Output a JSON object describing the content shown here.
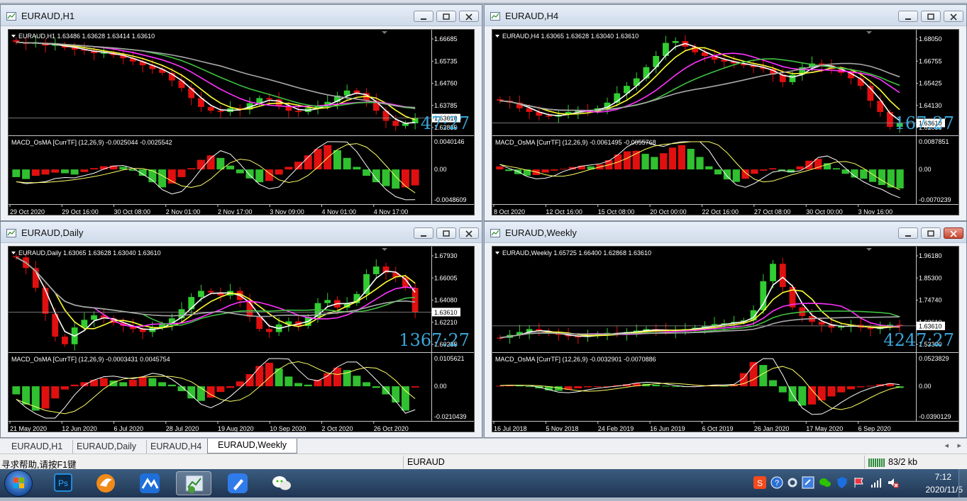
{
  "colors": {
    "bull_candle": "#32cd32",
    "bear_candle": "#e01010",
    "ma_white": "#ffffff",
    "ma_yellow": "#ffff33",
    "ma_magenta": "#ff33ff",
    "ma_green": "#40c040",
    "ma_gray": "#a8a8a8",
    "osma_up": "#e01010",
    "osma_down": "#30c030",
    "timer_text": "#3aa6d8",
    "price_tag_bg": "#ffffff"
  },
  "windows": [
    {
      "id": "h1",
      "title": "EURAUD,H1",
      "close_red": false,
      "chart_header": "EURAUD,H1  1.63486 1.63628 1.63414 1.63610",
      "price_labels": [
        "1.66685",
        "1.65735",
        "1.64760",
        "1.63785",
        "1.62835"
      ],
      "current_price": "1.63610",
      "timer": "47:27",
      "indicator_header": "MACD_OsMA [CurrTF] (12,26,9) -0.0025044 -0.0025542",
      "indicator_labels": [
        "0.0040146",
        "0.00",
        "-0.0048609"
      ],
      "time_labels": [
        "29 Oct 2020",
        "29 Oct 16:00",
        "30 Oct 08:00",
        "2 Nov 01:00",
        "2 Nov 17:00",
        "3 Nov 09:00",
        "4 Nov 01:00",
        "4 Nov 17:00"
      ],
      "series": {
        "price": [
          1.6662,
          1.6655,
          1.666,
          1.6648,
          1.6652,
          1.664,
          1.6632,
          1.6628,
          1.6618,
          1.662,
          1.661,
          1.6598,
          1.6585,
          1.657,
          1.6555,
          1.654,
          1.651,
          1.648,
          1.644,
          1.6405,
          1.639,
          1.6385,
          1.64,
          1.6395,
          1.642,
          1.644,
          1.6435,
          1.641,
          1.639,
          1.6385,
          1.64,
          1.641,
          1.6425,
          1.645,
          1.647,
          1.646,
          1.643,
          1.639,
          1.635,
          1.633,
          1.634,
          1.6361
        ],
        "osma": [
          -0.0012,
          -0.0015,
          -0.001,
          -0.0008,
          -0.0005,
          -0.0006,
          -0.0008,
          -0.0004,
          0.0002,
          0.0005,
          0.0006,
          0.0004,
          -0.0002,
          -0.001,
          -0.002,
          -0.0028,
          -0.0022,
          -0.0012,
          0.0002,
          0.0015,
          0.0022,
          0.0018,
          0.0006,
          -0.0006,
          -0.0014,
          -0.002,
          -0.0018,
          -0.0008,
          0.0004,
          0.0012,
          0.0022,
          0.0032,
          0.0038,
          0.003,
          0.0018,
          0.0004,
          -0.001,
          -0.002,
          -0.0026,
          -0.003,
          -0.0028,
          -0.0025
        ]
      }
    },
    {
      "id": "h4",
      "title": "EURAUD,H4",
      "close_red": false,
      "chart_header": "EURAUD,H4  1.63065 1.63628 1.63040 1.63610",
      "price_labels": [
        "1.68050",
        "1.66755",
        "1.65425",
        "1.64130",
        "1.62835"
      ],
      "current_price": "1.63610",
      "timer": "167:27",
      "indicator_header": "MACD_OsMA [CurrTF] (12,26,9) -0.0061495 -0.0055768",
      "indicator_labels": [
        "0.0087851",
        "0.00",
        "-0.0070239"
      ],
      "time_labels": [
        "8 Oct 2020",
        "12 Oct 16:00",
        "15 Oct 08:00",
        "20 Oct 00:00",
        "22 Oct 16:00",
        "27 Oct 08:00",
        "30 Oct 00:00",
        "3 Nov 16:00"
      ],
      "series": {
        "price": [
          1.648,
          1.647,
          1.644,
          1.642,
          1.64,
          1.6395,
          1.6405,
          1.642,
          1.643,
          1.6425,
          1.644,
          1.647,
          1.652,
          1.656,
          1.66,
          1.666,
          1.672,
          1.679,
          1.68,
          1.677,
          1.674,
          1.672,
          1.67,
          1.669,
          1.668,
          1.667,
          1.666,
          1.665,
          1.662,
          1.658,
          1.662,
          1.666,
          1.668,
          1.667,
          1.665,
          1.663,
          1.66,
          1.656,
          1.648,
          1.642,
          1.634,
          1.6361
        ],
        "osma": [
          0.001,
          -0.0005,
          -0.0015,
          -0.002,
          -0.0018,
          -0.001,
          -0.0004,
          0.0002,
          0.0008,
          0.0012,
          0.001,
          0.0016,
          0.003,
          0.0048,
          0.0058,
          0.006,
          0.005,
          0.004,
          0.0052,
          0.007,
          0.0078,
          0.0066,
          0.004,
          0.001,
          -0.0016,
          -0.0032,
          -0.004,
          -0.003,
          -0.0014,
          -0.0004,
          0.0004,
          -0.0004,
          -0.001,
          0.001,
          0.0028,
          0.0034,
          0.002,
          0.0004,
          -0.0014,
          -0.0026,
          -0.003,
          -0.004,
          -0.005,
          -0.0058,
          -0.0061
        ]
      }
    },
    {
      "id": "daily",
      "title": "EURAUD,Daily",
      "close_red": false,
      "chart_header": "EURAUD,Daily  1.63065 1.63628 1.63040 1.63610",
      "price_labels": [
        "1.67930",
        "1.66005",
        "1.64080",
        "1.62210",
        "1.60285"
      ],
      "current_price": "1.63610",
      "timer": "1367:27",
      "indicator_header": "MACD_OsMA [CurrTF] (12,26,9) -0.0003431 0.0045754",
      "indicator_labels": [
        "0.0105621",
        "0.00",
        "-0.0210439"
      ],
      "time_labels": [
        "21 May 2020",
        "12 Jun 2020",
        "6 Jul 2020",
        "28 Jul 2020",
        "19 Aug 2020",
        "10 Sep 2020",
        "2 Oct 2020",
        "26 Oct 2020"
      ],
      "series": {
        "price": [
          1.672,
          1.665,
          1.652,
          1.635,
          1.62,
          1.615,
          1.626,
          1.631,
          1.634,
          1.632,
          1.629,
          1.627,
          1.625,
          1.623,
          1.626,
          1.628,
          1.632,
          1.638,
          1.646,
          1.65,
          1.649,
          1.647,
          1.65,
          1.644,
          1.633,
          1.625,
          1.623,
          1.628,
          1.63,
          1.627,
          1.633,
          1.642,
          1.644,
          1.639,
          1.642,
          1.648,
          1.661,
          1.666,
          1.662,
          1.659,
          1.652,
          1.6361
        ],
        "osma": [
          -0.002,
          -0.0045,
          -0.006,
          -0.0055,
          -0.003,
          -0.0008,
          0.0004,
          0.001,
          0.0016,
          0.002,
          0.0014,
          0.001,
          0.0016,
          0.0024,
          0.002,
          0.001,
          0.0004,
          -0.0012,
          -0.003,
          -0.0036,
          -0.0028,
          -0.0014,
          -0.0004,
          0.0012,
          0.003,
          0.005,
          0.0058,
          0.0044,
          0.0024,
          0.0008,
          0.0004,
          0.0016,
          0.0032,
          0.0046,
          0.004,
          0.0026,
          0.001,
          -0.0004,
          -0.002,
          -0.004,
          -0.006,
          -0.0003
        ]
      }
    },
    {
      "id": "weekly",
      "title": "EURAUD,Weekly",
      "close_red": true,
      "chart_header": "EURAUD,Weekly  1.65725 1.66400 1.62868 1.63610",
      "price_labels": [
        "1.96180",
        "1.85300",
        "1.74740",
        "1.63610",
        "1.53300"
      ],
      "current_price": "1.63610",
      "timer": "4247:27",
      "indicator_header": "MACD_OsMA [CurrTF] (12,26,9) -0.0032901 -0.0070886",
      "indicator_labels": [
        "0.0523829",
        "0.00",
        "-0.0390129"
      ],
      "time_labels": [
        "16 Jul 2018",
        "5 Nov 2018",
        "24 Feb 2019",
        "16 Jun 2019",
        "6 Oct 2019",
        "26 Jan 2020",
        "17 May 2020",
        "6 Sep 2020"
      ],
      "series": {
        "price": [
          1.595,
          1.605,
          1.615,
          1.625,
          1.618,
          1.61,
          1.605,
          1.6,
          1.598,
          1.602,
          1.608,
          1.612,
          1.61,
          1.615,
          1.62,
          1.625,
          1.622,
          1.618,
          1.622,
          1.625,
          1.63,
          1.635,
          1.642,
          1.645,
          1.65,
          1.655,
          1.69,
          1.79,
          1.85,
          1.77,
          1.7,
          1.67,
          1.65,
          1.64,
          1.63,
          1.635,
          1.64,
          1.63,
          1.625,
          1.63,
          1.64,
          1.6361
        ],
        "osma": [
          0.001,
          0.0018,
          0.0012,
          0.0,
          -0.004,
          -0.008,
          -0.009,
          -0.007,
          -0.004,
          -0.002,
          -0.0008,
          0.0,
          0.002,
          0.004,
          0.006,
          0.005,
          0.003,
          0.001,
          -0.0006,
          -0.001,
          0.0004,
          0.002,
          0.0024,
          0.001,
          0.004,
          0.026,
          0.048,
          0.042,
          0.012,
          -0.012,
          -0.03,
          -0.038,
          -0.036,
          -0.028,
          -0.02,
          -0.012,
          -0.006,
          -0.002,
          0.001,
          0.004,
          0.006,
          -0.0033
        ]
      }
    }
  ],
  "tabs": [
    "EURAUD,H1",
    "EURAUD,Daily",
    "EURAUD,H4",
    "EURAUD,Weekly"
  ],
  "active_tab": 3,
  "statusbar": {
    "help": "寻求帮助,请按F1键",
    "symbol": "EURAUD",
    "traffic": "83/2 kb"
  },
  "taskbar": {
    "apps": [
      "windows-start-icon",
      "photoshop-icon",
      "foxmail-icon",
      "app-blue-wave-icon",
      "metatrader-icon",
      "feishu-icon",
      "wechat-icon"
    ],
    "ps_label": "Ps",
    "time": "7:12",
    "date": "2020/11/5"
  }
}
